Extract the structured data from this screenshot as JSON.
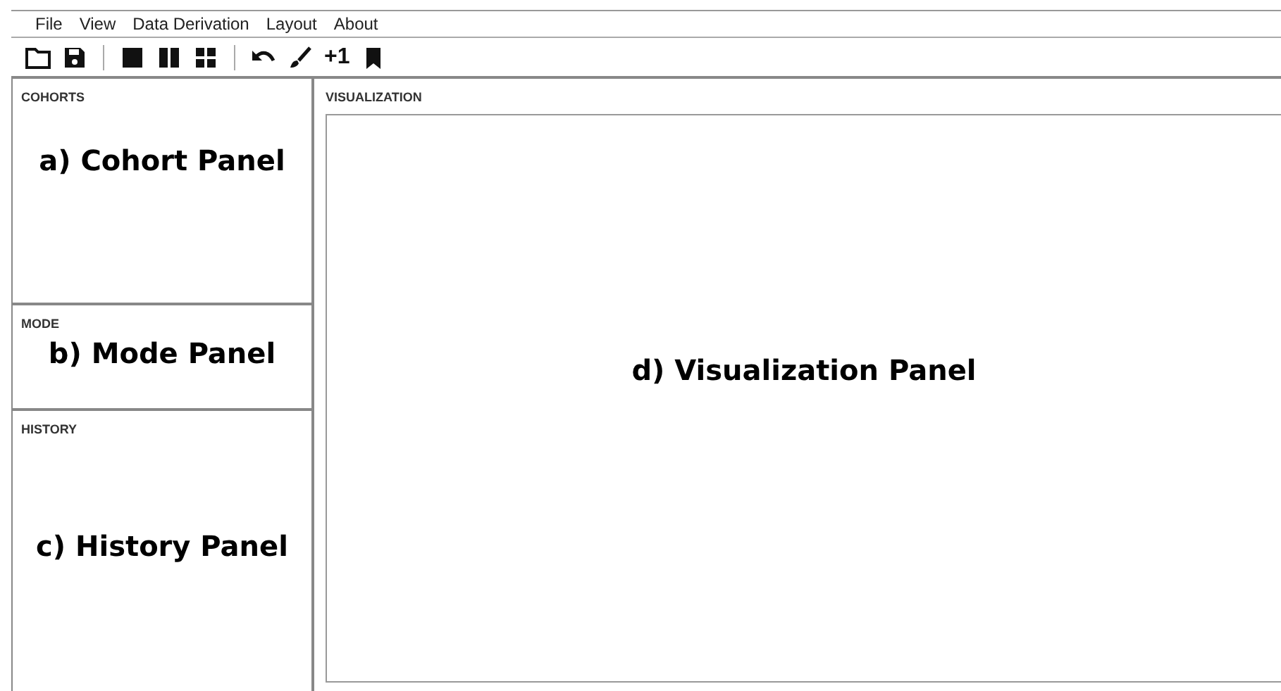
{
  "menu": [
    "File",
    "View",
    "Data Derivation",
    "Layout",
    "About"
  ],
  "toolbar": {
    "count_button": "+1"
  },
  "panels": [
    {
      "title": "COHORTS",
      "annotation": "a) Cohort Panel"
    },
    {
      "title": "MODE",
      "annotation": "b) Mode Panel"
    },
    {
      "title": "HISTORY",
      "annotation": "c) History Panel"
    }
  ],
  "visualization": {
    "title": "VISUALIZATION",
    "annotation": "d) Visualization Panel"
  }
}
